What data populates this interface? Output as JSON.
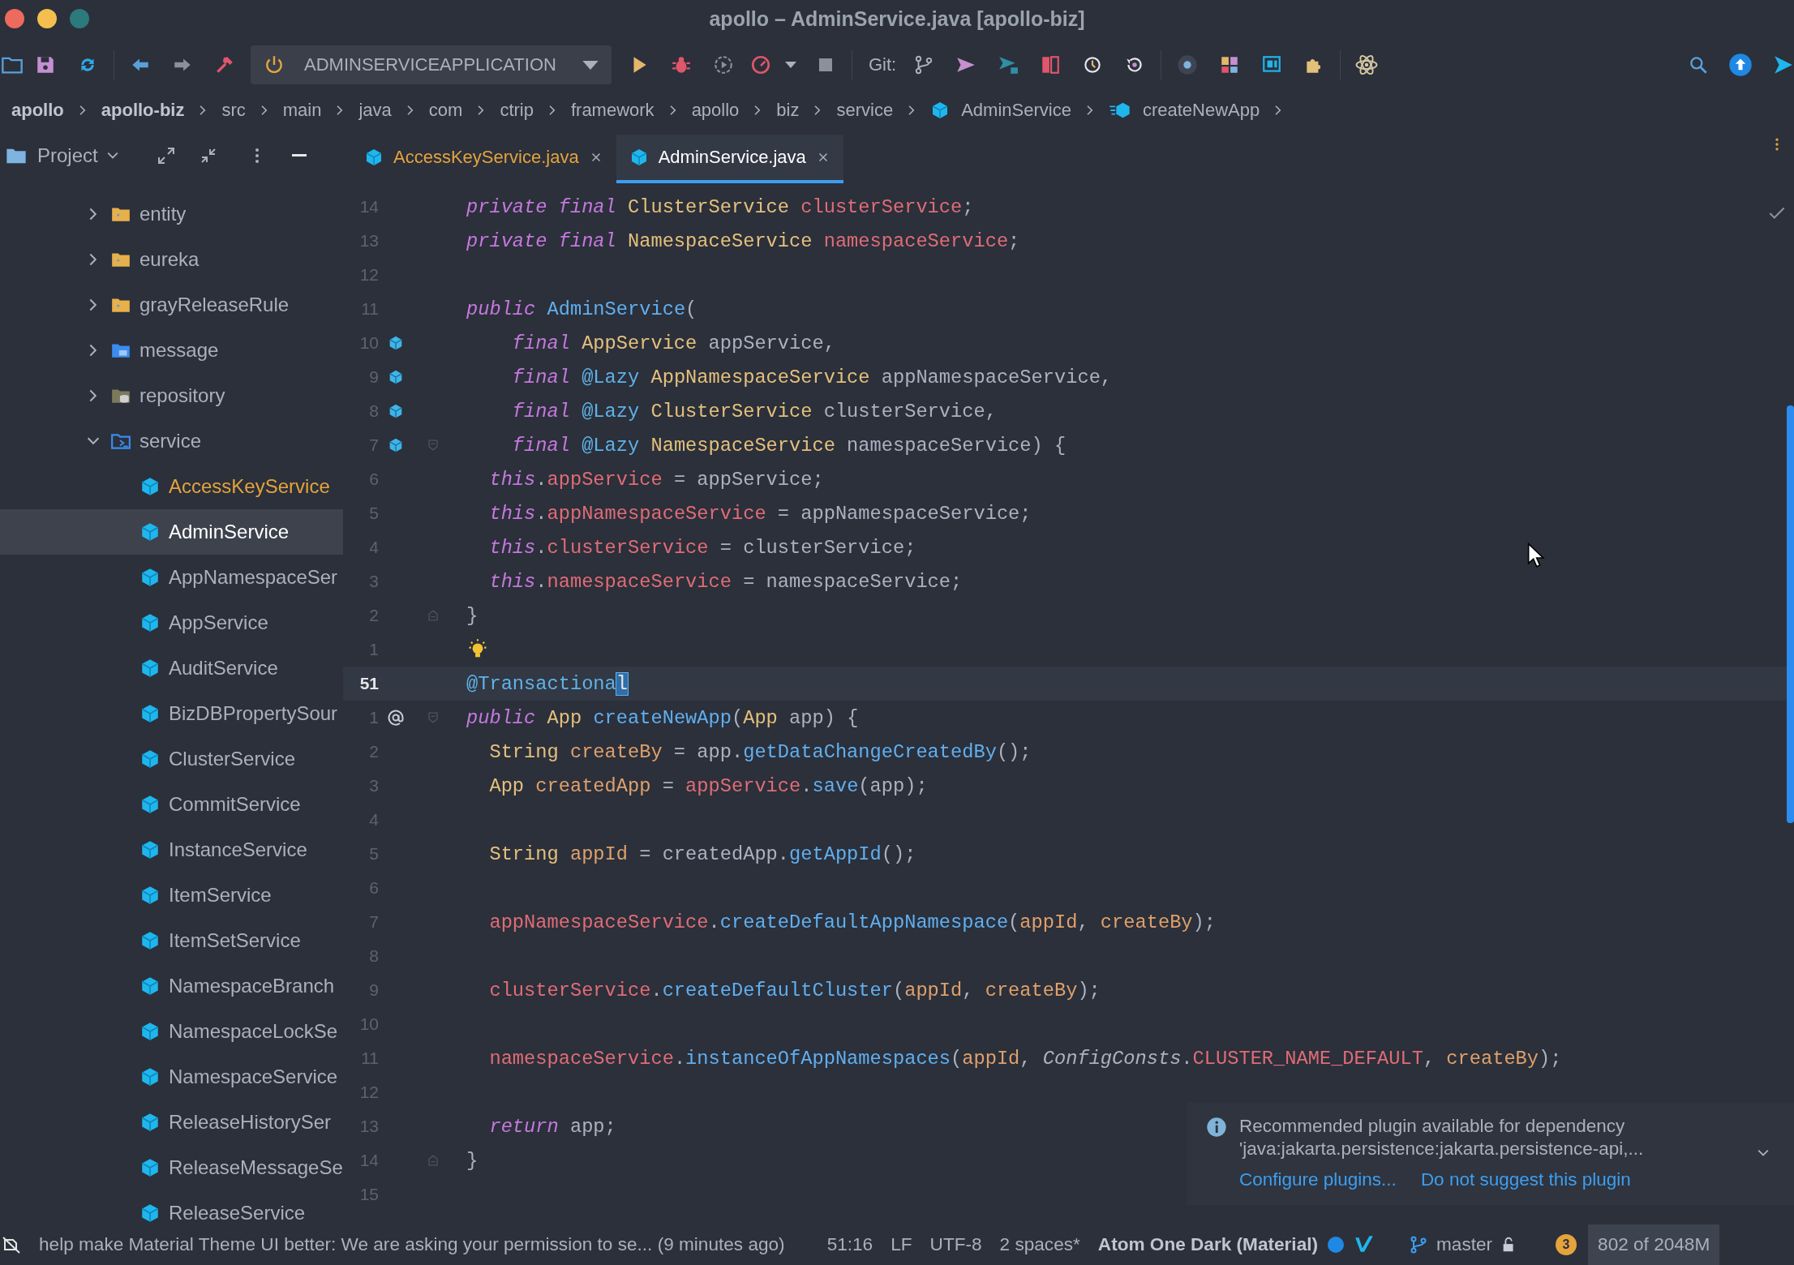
{
  "window": {
    "title": "apollo – AdminService.java [apollo-biz]"
  },
  "toolbar": {
    "run_configuration": "ADMINSERVICEAPPLICATION",
    "git_label": "Git:"
  },
  "breadcrumbs": [
    {
      "label": "apollo",
      "kind": "module"
    },
    {
      "label": "apollo-biz",
      "kind": "module"
    },
    {
      "label": "src",
      "kind": "dir"
    },
    {
      "label": "main",
      "kind": "dir"
    },
    {
      "label": "java",
      "kind": "dir"
    },
    {
      "label": "com",
      "kind": "dir"
    },
    {
      "label": "ctrip",
      "kind": "dir"
    },
    {
      "label": "framework",
      "kind": "dir"
    },
    {
      "label": "apollo",
      "kind": "dir"
    },
    {
      "label": "biz",
      "kind": "dir"
    },
    {
      "label": "service",
      "kind": "dir"
    },
    {
      "label": "AdminService",
      "kind": "class"
    },
    {
      "label": "createNewApp",
      "kind": "method"
    }
  ],
  "project_panel": {
    "title": "Project",
    "tree": [
      {
        "label": "entity",
        "kind": "folder",
        "expanded": false,
        "selected": false
      },
      {
        "label": "eureka",
        "kind": "folder",
        "expanded": false,
        "selected": false
      },
      {
        "label": "grayReleaseRule",
        "kind": "folder",
        "expanded": false,
        "selected": false
      },
      {
        "label": "message",
        "kind": "message-folder",
        "expanded": false,
        "selected": false
      },
      {
        "label": "repository",
        "kind": "db-folder",
        "expanded": false,
        "selected": false
      },
      {
        "label": "service",
        "kind": "source-folder",
        "expanded": true,
        "selected": false,
        "children": [
          {
            "label": "AccessKeyService",
            "kind": "class",
            "selected": false,
            "modified": true
          },
          {
            "label": "AdminService",
            "kind": "class",
            "selected": true,
            "modified": false
          },
          {
            "label": "AppNamespaceSer",
            "kind": "class",
            "selected": false,
            "modified": false
          },
          {
            "label": "AppService",
            "kind": "class",
            "selected": false,
            "modified": false
          },
          {
            "label": "AuditService",
            "kind": "class",
            "selected": false,
            "modified": false
          },
          {
            "label": "BizDBPropertySour",
            "kind": "class",
            "selected": false,
            "modified": false
          },
          {
            "label": "ClusterService",
            "kind": "class",
            "selected": false,
            "modified": false
          },
          {
            "label": "CommitService",
            "kind": "class",
            "selected": false,
            "modified": false
          },
          {
            "label": "InstanceService",
            "kind": "class",
            "selected": false,
            "modified": false
          },
          {
            "label": "ItemService",
            "kind": "class",
            "selected": false,
            "modified": false
          },
          {
            "label": "ItemSetService",
            "kind": "class",
            "selected": false,
            "modified": false
          },
          {
            "label": "NamespaceBranch",
            "kind": "class",
            "selected": false,
            "modified": false
          },
          {
            "label": "NamespaceLockSe",
            "kind": "class",
            "selected": false,
            "modified": false
          },
          {
            "label": "NamespaceService",
            "kind": "class",
            "selected": false,
            "modified": false
          },
          {
            "label": "ReleaseHistorySer",
            "kind": "class",
            "selected": false,
            "modified": false
          },
          {
            "label": "ReleaseMessageSe",
            "kind": "class",
            "selected": false,
            "modified": false
          },
          {
            "label": "ReleaseService",
            "kind": "class",
            "selected": false,
            "modified": false
          }
        ]
      }
    ]
  },
  "tabs": [
    {
      "label": "AccessKeyService.java",
      "selected": false,
      "modified": true
    },
    {
      "label": "AdminService.java",
      "selected": true,
      "modified": false
    }
  ],
  "editor": {
    "lines": [
      {
        "number": "14",
        "current": false,
        "tokens": [
          {
            "text": "private final ",
            "kind": "kw"
          },
          {
            "text": "ClusterService",
            "kind": "type"
          },
          {
            "text": " clusterService",
            "kind": "field"
          },
          {
            "text": ";",
            "kind": "plain"
          }
        ]
      },
      {
        "number": "13",
        "current": false,
        "tokens": [
          {
            "text": "private final ",
            "kind": "kw"
          },
          {
            "text": "NamespaceService",
            "kind": "type"
          },
          {
            "text": " namespaceService",
            "kind": "field"
          },
          {
            "text": ";",
            "kind": "plain"
          }
        ]
      },
      {
        "number": "12",
        "current": false
      },
      {
        "number": "11",
        "current": false,
        "tokens": [
          {
            "text": "public ",
            "kind": "kw"
          },
          {
            "text": "AdminService",
            "kind": "fn"
          },
          {
            "text": "(",
            "kind": "plain"
          }
        ]
      },
      {
        "number": "10",
        "current": false,
        "marker": {
          "kind": "bean"
        },
        "tokens": [
          {
            "text": "    final ",
            "kind": "kw"
          },
          {
            "text": "AppService",
            "kind": "type"
          },
          {
            "text": " appService,",
            "kind": "plain"
          }
        ]
      },
      {
        "number": "9",
        "current": false,
        "marker": {
          "kind": "bean"
        },
        "tokens": [
          {
            "text": "    final ",
            "kind": "kw"
          },
          {
            "text": "@Lazy ",
            "kind": "anno"
          },
          {
            "text": "AppNamespaceService",
            "kind": "type"
          },
          {
            "text": " appNamespaceService,",
            "kind": "plain"
          }
        ]
      },
      {
        "number": "8",
        "current": false,
        "marker": {
          "kind": "bean"
        },
        "tokens": [
          {
            "text": "    final ",
            "kind": "kw"
          },
          {
            "text": "@Lazy ",
            "kind": "anno"
          },
          {
            "text": "ClusterService",
            "kind": "type"
          },
          {
            "text": " clusterService,",
            "kind": "plain"
          }
        ]
      },
      {
        "number": "7",
        "current": false,
        "marker": {
          "kind": "bean"
        },
        "fold": {
          "kind": "open"
        },
        "tokens": [
          {
            "text": "    final ",
            "kind": "kw"
          },
          {
            "text": "@Lazy ",
            "kind": "anno"
          },
          {
            "text": "NamespaceService",
            "kind": "type"
          },
          {
            "text": " namespaceService) {",
            "kind": "plain"
          }
        ]
      },
      {
        "number": "6",
        "current": false,
        "tokens": [
          {
            "text": "  this",
            "kind": "kw"
          },
          {
            "text": ".",
            "kind": "plain"
          },
          {
            "text": "appService",
            "kind": "field"
          },
          {
            "text": " = appService;",
            "kind": "plain"
          }
        ]
      },
      {
        "number": "5",
        "current": false,
        "tokens": [
          {
            "text": "  this",
            "kind": "kw"
          },
          {
            "text": ".",
            "kind": "plain"
          },
          {
            "text": "appNamespaceService",
            "kind": "field"
          },
          {
            "text": " = appNamespaceService;",
            "kind": "plain"
          }
        ]
      },
      {
        "number": "4",
        "current": false,
        "tokens": [
          {
            "text": "  this",
            "kind": "kw"
          },
          {
            "text": ".",
            "kind": "plain"
          },
          {
            "text": "clusterService",
            "kind": "field"
          },
          {
            "text": " = clusterService;",
            "kind": "plain"
          }
        ]
      },
      {
        "number": "3",
        "current": false,
        "tokens": [
          {
            "text": "  this",
            "kind": "kw"
          },
          {
            "text": ".",
            "kind": "plain"
          },
          {
            "text": "namespaceService",
            "kind": "field"
          },
          {
            "text": " = namespaceService;",
            "kind": "plain"
          }
        ]
      },
      {
        "number": "2",
        "current": false,
        "fold": {
          "kind": "close"
        },
        "tokens": [
          {
            "text": "}",
            "kind": "plain"
          }
        ]
      },
      {
        "number": "1",
        "current": false,
        "marker": {
          "kind": "bulb"
        }
      },
      {
        "number": "51",
        "current": true,
        "tokens": [
          {
            "text": "@Transactiona",
            "kind": "anno"
          },
          {
            "text": "l",
            "kind": "anno",
            "caret": true
          }
        ]
      },
      {
        "number": "1",
        "current": false,
        "marker": {
          "kind": "at"
        },
        "fold": {
          "kind": "open"
        },
        "tokens": [
          {
            "text": "public ",
            "kind": "kw"
          },
          {
            "text": "App",
            "kind": "type"
          },
          {
            "text": " createNewApp",
            "kind": "fn"
          },
          {
            "text": "(",
            "kind": "plain"
          },
          {
            "text": "App",
            "kind": "type"
          },
          {
            "text": " app) {",
            "kind": "plain"
          }
        ]
      },
      {
        "number": "2",
        "current": false,
        "tokens": [
          {
            "text": "  String",
            "kind": "type"
          },
          {
            "text": " createBy",
            "kind": "var"
          },
          {
            "text": " = app.",
            "kind": "plain"
          },
          {
            "text": "getDataChangeCreatedBy",
            "kind": "fn"
          },
          {
            "text": "();",
            "kind": "plain"
          }
        ]
      },
      {
        "number": "3",
        "current": false,
        "tokens": [
          {
            "text": "  App",
            "kind": "type"
          },
          {
            "text": " createdApp",
            "kind": "var"
          },
          {
            "text": " = ",
            "kind": "plain"
          },
          {
            "text": "appService",
            "kind": "field"
          },
          {
            "text": ".",
            "kind": "plain"
          },
          {
            "text": "save",
            "kind": "fn"
          },
          {
            "text": "(app);",
            "kind": "plain"
          }
        ]
      },
      {
        "number": "4",
        "current": false
      },
      {
        "number": "5",
        "current": false,
        "tokens": [
          {
            "text": "  String",
            "kind": "type"
          },
          {
            "text": " appId",
            "kind": "var"
          },
          {
            "text": " = createdApp.",
            "kind": "plain"
          },
          {
            "text": "getAppId",
            "kind": "fn"
          },
          {
            "text": "();",
            "kind": "plain"
          }
        ]
      },
      {
        "number": "6",
        "current": false
      },
      {
        "number": "7",
        "current": false,
        "tokens": [
          {
            "text": "  appNamespaceService",
            "kind": "field"
          },
          {
            "text": ".",
            "kind": "plain"
          },
          {
            "text": "createDefaultAppNamespace",
            "kind": "fn"
          },
          {
            "text": "(",
            "kind": "plain"
          },
          {
            "text": "appId",
            "kind": "var"
          },
          {
            "text": ", ",
            "kind": "plain"
          },
          {
            "text": "createBy",
            "kind": "var"
          },
          {
            "text": ");",
            "kind": "plain"
          }
        ]
      },
      {
        "number": "8",
        "current": false
      },
      {
        "number": "9",
        "current": false,
        "tokens": [
          {
            "text": "  clusterService",
            "kind": "field"
          },
          {
            "text": ".",
            "kind": "plain"
          },
          {
            "text": "createDefaultCluster",
            "kind": "fn"
          },
          {
            "text": "(",
            "kind": "plain"
          },
          {
            "text": "appId",
            "kind": "var"
          },
          {
            "text": ", ",
            "kind": "plain"
          },
          {
            "text": "createBy",
            "kind": "var"
          },
          {
            "text": ");",
            "kind": "plain"
          }
        ]
      },
      {
        "number": "10",
        "current": false
      },
      {
        "number": "11",
        "current": false,
        "tokens": [
          {
            "text": "  namespaceService",
            "kind": "field"
          },
          {
            "text": ".",
            "kind": "plain"
          },
          {
            "text": "instanceOfAppNamespaces",
            "kind": "fn"
          },
          {
            "text": "(",
            "kind": "plain"
          },
          {
            "text": "appId",
            "kind": "var"
          },
          {
            "text": ", ",
            "kind": "plain"
          },
          {
            "text": "ConfigConsts",
            "kind": "static"
          },
          {
            "text": ".",
            "kind": "plain"
          },
          {
            "text": "CLUSTER_NAME_DEFAULT",
            "kind": "field"
          },
          {
            "text": ", ",
            "kind": "plain"
          },
          {
            "text": "createBy",
            "kind": "var"
          },
          {
            "text": ");",
            "kind": "plain"
          }
        ]
      },
      {
        "number": "12",
        "current": false
      },
      {
        "number": "13",
        "current": false,
        "tokens": [
          {
            "text": "  return",
            "kind": "kw"
          },
          {
            "text": " app;",
            "kind": "plain"
          }
        ]
      },
      {
        "number": "14",
        "current": false,
        "fold": {
          "kind": "close"
        },
        "tokens": [
          {
            "text": "}",
            "kind": "plain"
          }
        ]
      },
      {
        "number": "15",
        "current": false
      }
    ]
  },
  "notification": {
    "title": "Recommended plugin available for dependency",
    "detail": "'java:jakarta.persistence:jakarta.persistence-api,...",
    "links": [
      "Configure plugins...",
      "Do not suggest this plugin"
    ]
  },
  "status_bar": {
    "message": "help make Material Theme UI better: We are asking your permission to se... (9 minutes ago)",
    "items": [
      {
        "text": "51:16",
        "kind": "plain"
      },
      {
        "text": "LF",
        "kind": "plain"
      },
      {
        "text": "UTF-8",
        "kind": "plain"
      },
      {
        "text": "2 spaces*",
        "kind": "plain"
      },
      {
        "text": "Atom One Dark (Material)",
        "kind": "theme"
      },
      {
        "text": "master",
        "kind": "branch"
      },
      {
        "text": "3",
        "kind": "badge"
      },
      {
        "text": "802 of 2048M",
        "kind": "memory"
      }
    ]
  }
}
